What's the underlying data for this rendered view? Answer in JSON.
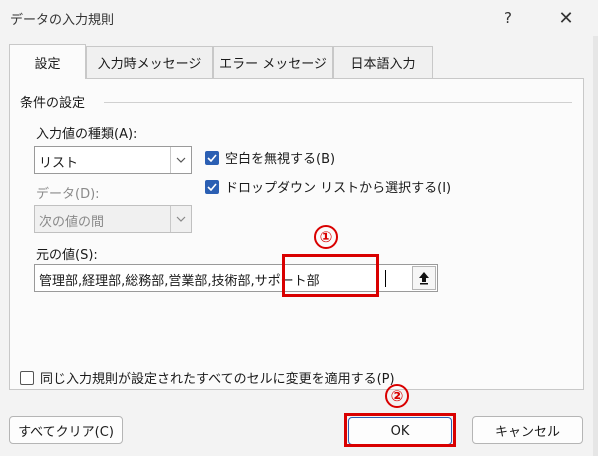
{
  "window": {
    "title": "データの入力規則",
    "help_label": "?",
    "close_label": "✕"
  },
  "tabs": [
    {
      "label": "設定",
      "active": true
    },
    {
      "label": "入力時メッセージ",
      "active": false
    },
    {
      "label": "エラー メッセージ",
      "active": false
    },
    {
      "label": "日本語入力",
      "active": false
    }
  ],
  "settings": {
    "group_label": "条件の設定",
    "allow_label": "入力値の種類(A):",
    "allow_value": "リスト",
    "data_label": "データ(D):",
    "data_value": "次の値の間",
    "ignore_blank_label": "空白を無視する(B)",
    "ignore_blank_checked": true,
    "dropdown_label": "ドロップダウン リストから選択する(I)",
    "dropdown_checked": true,
    "source_label": "元の値(S):",
    "source_value": "管理部,経理部,総務部,営業部,技術部,サポート部",
    "apply_all_label": "同じ入力規則が設定されたすべてのセルに変更を適用する(P)",
    "apply_all_checked": false
  },
  "annotations": {
    "marker1": "①",
    "marker2": "②",
    "color": "#d90000"
  },
  "buttons": {
    "clear": "すべてクリア(C)",
    "ok": "OK",
    "cancel": "キャンセル"
  },
  "colors": {
    "checkbox_accent": "#2b5fb3",
    "highlight": "#d90000"
  }
}
